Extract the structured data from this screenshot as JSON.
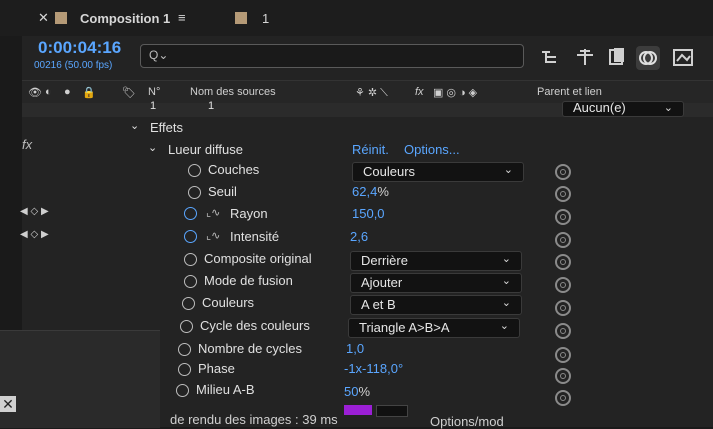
{
  "tabs": {
    "comp": "Composition 1",
    "menu": "≡",
    "second": "1"
  },
  "timeline": {
    "timecode": "0:00:04:16",
    "frames": "00216 (50.00 fps)",
    "search_placeholder": "Q⌄"
  },
  "headers": {
    "num": "N°",
    "source": "Nom des sources",
    "parent": "Parent et lien",
    "fx": "fx"
  },
  "layer": {
    "index": "1",
    "name": "1",
    "parent": "Aucun(e)"
  },
  "group": {
    "effects": "Effets",
    "fx": "fx",
    "effect_name": "Lueur diffuse",
    "reset": "Réinit.",
    "options": "Options..."
  },
  "props": [
    {
      "label": "Couches",
      "dropdown": "Couleurs"
    },
    {
      "label": "Seuil",
      "value": "62,4",
      "unit": "%"
    },
    {
      "label": "Rayon",
      "value": "150,0"
    },
    {
      "label": "Intensité",
      "value": "2,6"
    },
    {
      "label": "Composite original",
      "dropdown": "Derrière"
    },
    {
      "label": "Mode de fusion",
      "dropdown": "Ajouter"
    },
    {
      "label": "Couleurs",
      "dropdown": "A et B"
    },
    {
      "label": "Cycle des couleurs",
      "dropdown": "Triangle A>B>A"
    },
    {
      "label": "Nombre de cycles",
      "value": "1,0"
    },
    {
      "label": "Phase",
      "value": "-1x-118,0°"
    },
    {
      "label": "Milieu A-B",
      "value": "50",
      "unit": "%"
    }
  ],
  "footer": {
    "render": "de rendu des images : 39 ms",
    "options": "Options/mod"
  },
  "colors": {
    "accent": "#5aa6ff",
    "swatch": "#b59a77",
    "color_a": "#9b1fd6"
  }
}
